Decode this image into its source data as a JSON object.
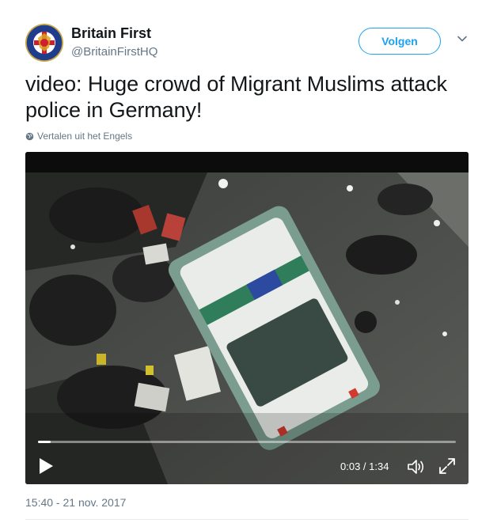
{
  "tweet": {
    "author": {
      "name": "Britain First",
      "handle": "@BritainFirstHQ"
    },
    "follow_label": "Volgen",
    "text": "video: Huge crowd of Migrant Muslims attack police in Germany!",
    "translate_label": "Vertalen uit het Engels",
    "timestamp": "15:40 - 21 nov. 2017"
  },
  "video": {
    "current_time": "0:03",
    "duration": "1:34",
    "time_display": "0:03 / 1:34",
    "progress": 0.03
  },
  "colors": {
    "accent": "#1da1f2",
    "muted_text": "#657786",
    "text": "#14171a"
  },
  "icons": {
    "avatar": "britain-first-logo",
    "menu": "chevron-down-icon",
    "translate": "globe-icon",
    "play": "play-icon",
    "volume": "volume-icon",
    "fullscreen": "fullscreen-icon"
  }
}
